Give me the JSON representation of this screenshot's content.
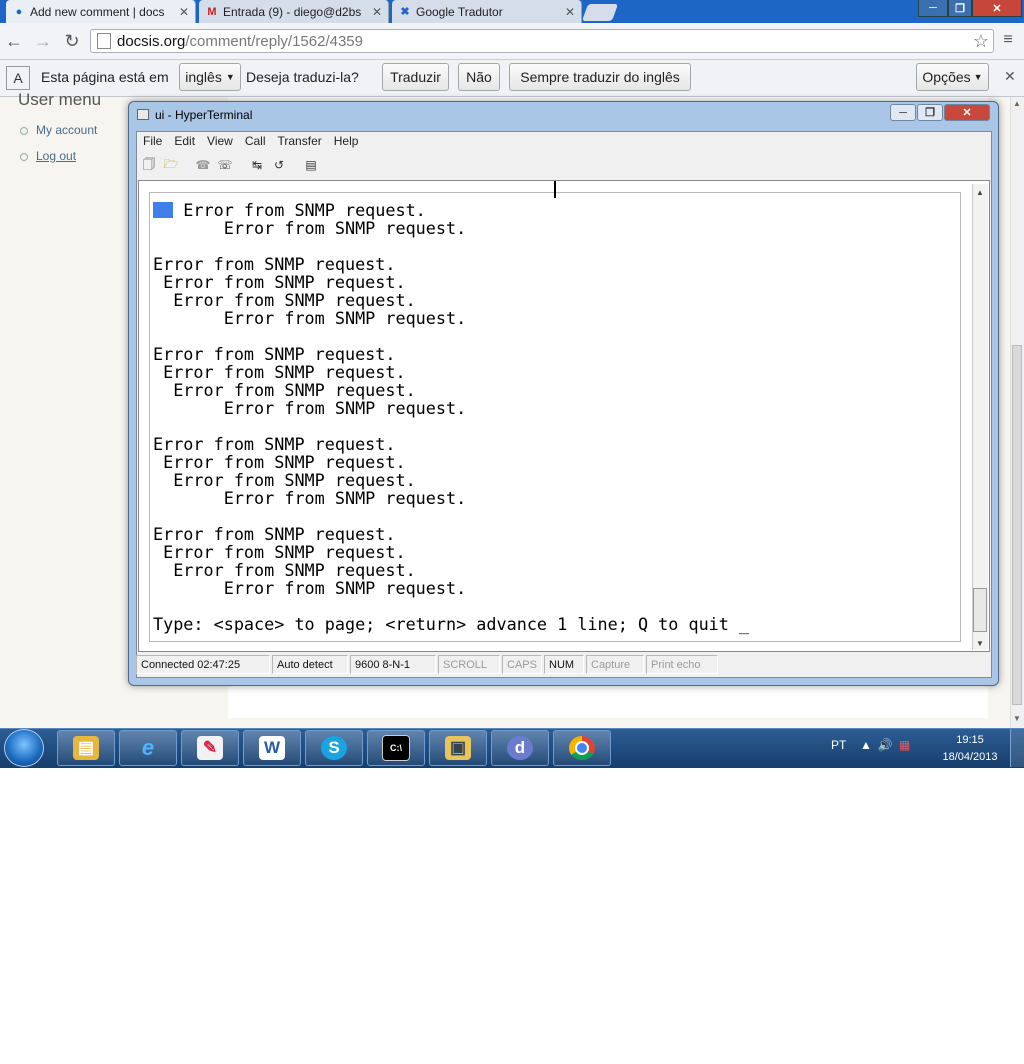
{
  "browser": {
    "tabs": [
      {
        "label": "Add new comment | docs",
        "icon": "drupal-icon",
        "active": true
      },
      {
        "label": "Entrada (9) - diego@d2bs",
        "icon": "gmail-icon",
        "active": false
      },
      {
        "label": "Google Tradutor",
        "icon": "translate-icon",
        "active": false
      }
    ],
    "url_host": "docsis.org",
    "url_path": "/comment/reply/1562/4359"
  },
  "translate_bar": {
    "prefix": "Esta página está em",
    "language": "inglês",
    "question": "Deseja traduzi-la?",
    "translate_button": "Traduzir",
    "no_button": "Não",
    "always_button": "Sempre traduzir do inglês",
    "options_button": "Opções"
  },
  "page": {
    "user_menu_title": "User menu",
    "links": [
      "My account",
      "Log out"
    ]
  },
  "hyperterminal": {
    "title": "ui - HyperTerminal",
    "menu": [
      "File",
      "Edit",
      "View",
      "Call",
      "Transfer",
      "Help"
    ],
    "terminal_text": "   Error from SNMP request.\n       Error from SNMP request.\n\nError from SNMP request.\n Error from SNMP request.\n  Error from SNMP request.\n       Error from SNMP request.\n\nError from SNMP request.\n Error from SNMP request.\n  Error from SNMP request.\n       Error from SNMP request.\n\nError from SNMP request.\n Error from SNMP request.\n  Error from SNMP request.\n       Error from SNMP request.\n\nError from SNMP request.\n Error from SNMP request.\n  Error from SNMP request.\n       Error from SNMP request.\n\nType: <space> to page; <return> advance 1 line; Q to quit _",
    "status": {
      "connected": "Connected 02:47:25",
      "detect": "Auto detect",
      "settings": "9600 8-N-1",
      "scroll": "SCROLL",
      "caps": "CAPS",
      "num": "NUM",
      "capture": "Capture",
      "print_echo": "Print echo"
    }
  },
  "taskbar": {
    "apps": [
      "explorer-icon",
      "ie-icon",
      "editor-icon",
      "word-icon",
      "skype-icon",
      "cmd-icon",
      "network-icon",
      "dreamweaver-icon",
      "chrome-icon"
    ],
    "language": "PT",
    "time": "19:15",
    "date": "18/04/2013"
  }
}
